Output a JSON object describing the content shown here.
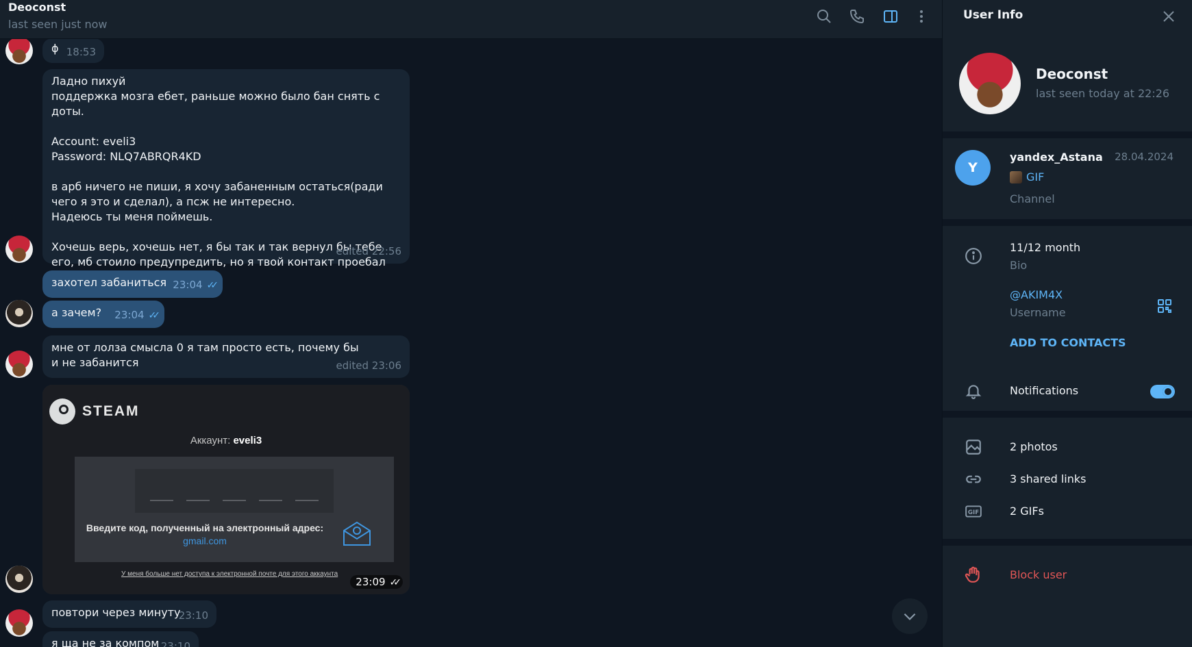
{
  "chat": {
    "peer_name": "Deoconst",
    "peer_status": "last seen just now",
    "header_icons": [
      "search-icon",
      "phone-icon",
      "sidebar-toggle-icon",
      "more-vertical-icon"
    ]
  },
  "messages": [
    {
      "id": "m1",
      "text": "ϕ",
      "time": "18:53"
    },
    {
      "id": "m2",
      "text": "Ладно пихуй\nподдержка мозга ебет, раньше можно было бан снять с доты.\n\nAccount: eveli3\nPassword: NLQ7ABRQR4KD\n\nв арб ничего не пиши, я хочу забаненным остаться(ради чего я это и сделал), а псж не интересно.\nНадеюсь ты меня поймешь.\n\nХочешь верь, хочешь нет, я бы так и так вернул бы тебе его, мб стоило предупредить, но я твой контакт проебал",
      "time": "edited 22:56"
    },
    {
      "id": "m3",
      "text": "захотел забаниться",
      "time": "23:04",
      "read": "✓✓"
    },
    {
      "id": "m4",
      "text": "а зачем?",
      "time": "23:04",
      "read": "✓✓"
    },
    {
      "id": "m5",
      "text": "мне от лолза смысла 0 я там просто есть, почему бы и не забанится",
      "time": "edited 23:06"
    },
    {
      "id": "m7",
      "text": "повтори через минуту",
      "time": "23:10"
    },
    {
      "id": "m8",
      "text": "я ща не за компом",
      "time": "23:10"
    }
  ],
  "steam_image": {
    "brand": "STEAM",
    "account_label": "Аккаунт:",
    "account_value": "eveli3",
    "prompt": "Введите код, полученный на электронный адрес:",
    "email": "gmail.com",
    "note": "У меня больше нет доступа к электронной почте для этого аккаунта",
    "time": "23:09",
    "read": "✓✓"
  },
  "panel": {
    "title": "User Info",
    "name": "Deoconst",
    "status": "last seen today at 22:26",
    "channel": {
      "initial": "Y",
      "name": "yandex_Astana",
      "date": "28.04.2024",
      "last_message": "GIF",
      "type": "Channel"
    },
    "bio": {
      "value": "11/12 month",
      "label": "Bio"
    },
    "username": {
      "value": "@AKIM4X",
      "label": "Username"
    },
    "add_contacts": "ADD TO CONTACTS",
    "notifications": {
      "label": "Notifications",
      "enabled": true
    },
    "media": {
      "photos": "2 photos",
      "links": "3 shared links",
      "gifs": "2 GIFs"
    },
    "block": "Block user"
  },
  "colors": {
    "bg": "#0e1621",
    "header": "#17212b",
    "incoming": "#182533",
    "outgoing": "#2b5278",
    "accent": "#5eb5f7",
    "danger": "#e25656",
    "muted": "#6d7f8f"
  }
}
